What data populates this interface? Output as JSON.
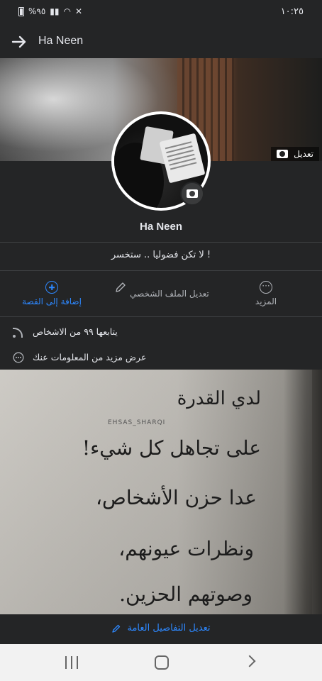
{
  "status_bar": {
    "time": "١٠:٢٥",
    "battery": "%٩٥",
    "icons": [
      "battery-icon",
      "signal-icon",
      "wifi-icon",
      "mute-icon"
    ]
  },
  "header": {
    "title": "Ha Neen",
    "back_icon": "arrow-icon"
  },
  "cover": {
    "edit_label": "تعديل",
    "edit_icon": "camera-icon"
  },
  "profile": {
    "name": "Ha Neen",
    "bio": "لا تكن فضوليا .. ستخسر !",
    "avatar_camera_icon": "camera-icon"
  },
  "actions": [
    {
      "label": "إضافة إلى القصة",
      "icon": "plus-circle-icon",
      "color": "#2d88ff"
    },
    {
      "label": "تعديل الملف الشخصي",
      "icon": "pencil-icon"
    },
    {
      "label": "المزيد",
      "icon": "more-dots-icon"
    }
  ],
  "info": {
    "followers": "يتابعها ٩٩ من الاشخاص",
    "more_info": "عرض مزيد من المعلومات عنك"
  },
  "featured_photo": {
    "watermark": "EHSAS_SHARQI",
    "lines": [
      "لدي القدرة",
      "على تجاهل كل شيء!",
      "عدا حزن الأشخاص،",
      "ونظرات عيونهم،",
      "وصوتهم الحزين."
    ]
  },
  "edit_details": {
    "label": "تعديل التفاصيل العامة",
    "icon": "pencil-icon"
  },
  "colors": {
    "background": "#242526",
    "accent": "#2d88ff",
    "text": "#e4e6eb",
    "secondary_text": "#b0b3b8",
    "nav_bar": "#f2f2f2"
  }
}
